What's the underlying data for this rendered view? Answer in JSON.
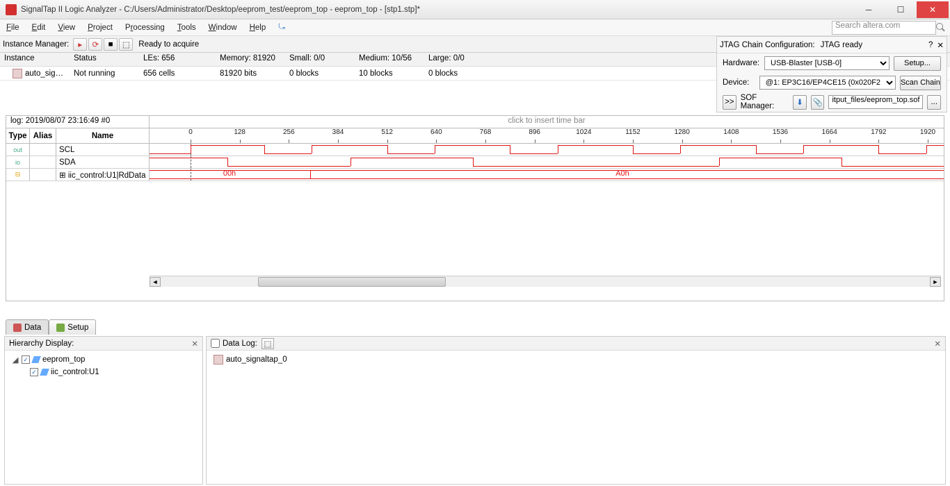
{
  "window": {
    "title": "SignalTap II Logic Analyzer - C:/Users/Administrator/Desktop/eeprom_test/eeprom_top - eeprom_top - [stp1.stp]*"
  },
  "menu": {
    "file": "File",
    "edit": "Edit",
    "view": "View",
    "project": "Project",
    "processing": "Processing",
    "tools": "Tools",
    "window": "Window",
    "help": "Help",
    "search_placeholder": "Search altera.com"
  },
  "instance_manager": {
    "label": "Instance Manager:",
    "status": "Ready to acquire",
    "headers": {
      "instance": "Instance",
      "status": "Status",
      "les": "LEs: 656",
      "memory": "Memory: 81920",
      "small": "Small: 0/0",
      "medium": "Medium: 10/56",
      "large": "Large: 0/0"
    },
    "row": {
      "name": "auto_sig…",
      "status": "Not running",
      "les": "656 cells",
      "memory": "81920 bits",
      "small": "0 blocks",
      "medium": "10 blocks",
      "large": "0 blocks"
    }
  },
  "jtag": {
    "title": "JTAG Chain Configuration:",
    "status": "JTAG ready",
    "hw_label": "Hardware:",
    "hw_value": "USB-Blaster [USB-0]",
    "setup": "Setup...",
    "dev_label": "Device:",
    "dev_value": "@1: EP3C16/EP4CE15 (0x020F2",
    "scan": "Scan Chain",
    "sof_label": "SOF Manager:",
    "sof_path": "itput_files/eeprom_top.sof",
    "more": "..."
  },
  "wave": {
    "log": "log: 2019/08/07 23:16:49  #0",
    "insert": "click to insert time bar",
    "headers": {
      "type": "Type",
      "alias": "Alias",
      "name": "Name"
    },
    "ticks": [
      "0",
      "128",
      "256",
      "384",
      "512",
      "640",
      "768",
      "896",
      "1024",
      "1152",
      "1280",
      "1408",
      "1536",
      "1664",
      "1792",
      "1920"
    ],
    "rows": [
      {
        "type": "out",
        "name": "SCL"
      },
      {
        "type": "io",
        "name": "SDA"
      },
      {
        "type": "⊞",
        "name": "⊞ iic_control:U1|RdData"
      }
    ],
    "bus": {
      "v1": "00h",
      "v2": "A0h"
    }
  },
  "tabs": {
    "data": "Data",
    "setup": "Setup"
  },
  "hier": {
    "title": "Hierarchy Display:",
    "items": [
      "eeprom_top",
      "iic_control:U1"
    ]
  },
  "datalog": {
    "title": "Data Log:",
    "item": "auto_signaltap_0"
  }
}
